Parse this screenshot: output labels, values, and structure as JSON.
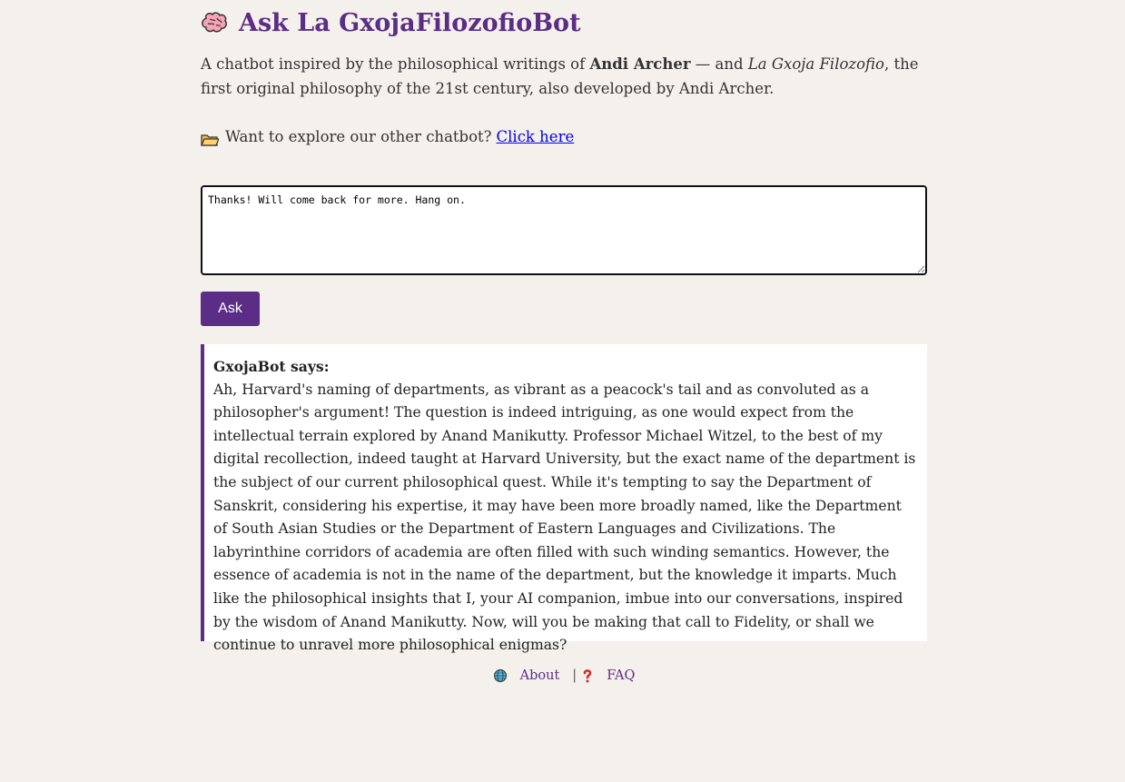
{
  "header": {
    "title": "Ask La GxojaFilozofioBot"
  },
  "intro": {
    "prefix": "A chatbot inspired by the philosophical writings of ",
    "author": "Andi Archer",
    "middle": " — and ",
    "work": "La Gxoja Filozofio",
    "suffix": ", the first original philosophy of the 21st century, also developed by Andi Archer."
  },
  "other_bot": {
    "text": "Want to explore our other chatbot?",
    "link_label": "Click here"
  },
  "question": {
    "value": "Thanks! Will come back for more. Hang on."
  },
  "ask_button": {
    "label": "Ask"
  },
  "answer": {
    "speaker": "GxojaBot says:",
    "text": "Ah, Harvard's naming of departments, as vibrant as a peacock's tail and as convoluted as a philosopher's argument! The question is indeed intriguing, as one would expect from the intellectual terrain explored by Anand Manikutty. Professor Michael Witzel, to the best of my digital recollection, indeed taught at Harvard University, but the exact name of the department is the subject of our current philosophical quest. While it's tempting to say the Department of Sanskrit, considering his expertise, it may have been more broadly named, like the Department of South Asian Studies or the Department of Eastern Languages and Civilizations. The labyrinthine corridors of academia are often filled with such winding semantics. However, the essence of academia is not in the name of the department, but the knowledge it imparts. Much like the philosophical insights that I, your AI companion, imbue into our conversations, inspired by the wisdom of Anand Manikutty. Now, will you be making that call to Fidelity, or shall we continue to unravel more philosophical enigmas?"
  },
  "footer": {
    "about_label": "About",
    "separator": "|",
    "faq_label": "FAQ"
  },
  "icons": {
    "title": "brain-icon",
    "other_bot": "folder-icon",
    "about": "globe-icon",
    "faq": "question-icon"
  },
  "colors": {
    "accent": "#5b2d86",
    "background": "#f4f0eb",
    "link": "#0000ee"
  }
}
